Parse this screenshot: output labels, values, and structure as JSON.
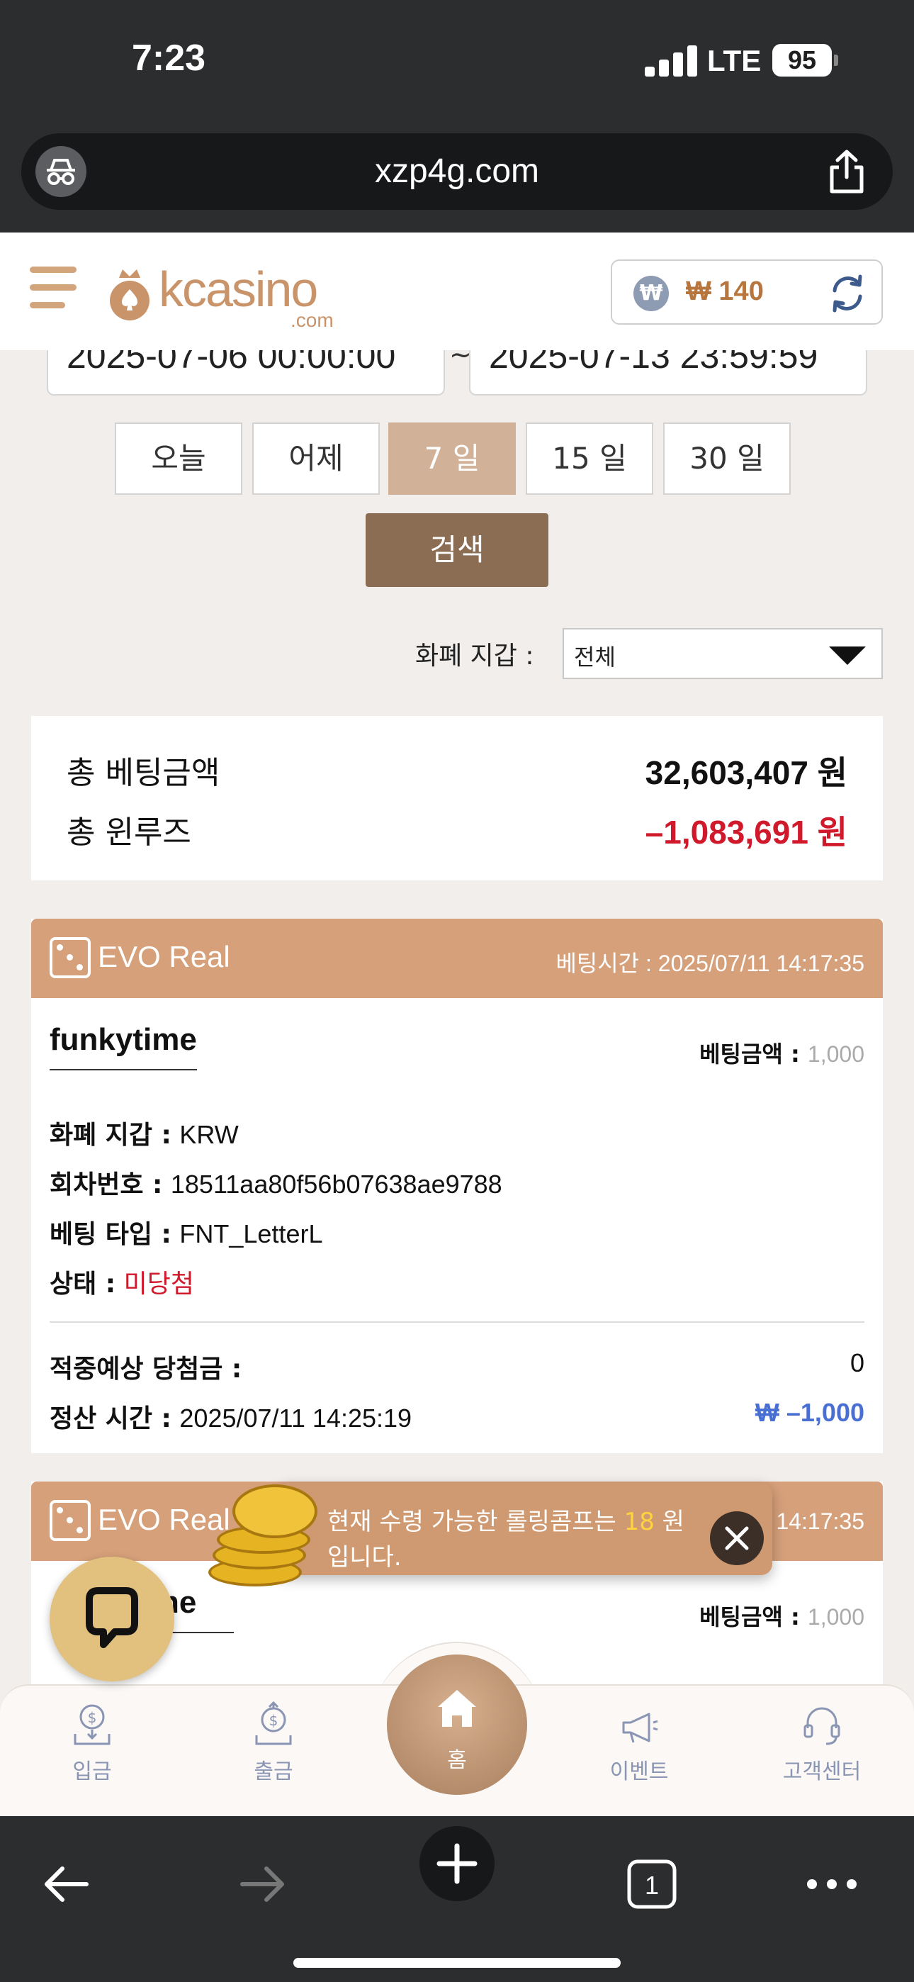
{
  "status_bar": {
    "time": "7:23",
    "network": "LTE",
    "battery": "95"
  },
  "browser": {
    "url": "xzp4g.com",
    "tab_count": "1"
  },
  "header": {
    "logo_main": "kcasino",
    "logo_sub": ".com",
    "balance": "₩ 140",
    "currency_symbol": "₩"
  },
  "filters": {
    "date_from": "2025-07-06 00:00:00",
    "date_to": "2025-07-13 23:59:59",
    "separator": "~",
    "periods": [
      "오늘",
      "어제",
      "7 일",
      "15 일",
      "30 일"
    ],
    "active_period": "7 일",
    "search_label": "검색",
    "wallet_label": "화폐 지갑 :",
    "wallet_value": "전체"
  },
  "summary": {
    "total_bet_label": "총 베팅금액",
    "total_bet_value": "32,603,407 원",
    "total_winloss_label": "총 윈루즈",
    "total_winloss_value": "–1,083,691 원"
  },
  "bets": [
    {
      "provider": "EVO Real",
      "bet_time_label": "베팅시간 :",
      "bet_time": "2025/07/11 14:17:35",
      "game": "funkytime",
      "bet_amount_label": "베팅금액 :",
      "bet_amount": "1,000",
      "wallet_label": "화폐 지갑 :",
      "wallet": "KRW",
      "round_label": "회차번호 :",
      "round": "18511aa80f56b07638ae9788",
      "bet_type_label": "베팅 타입 :",
      "bet_type": "FNT_LetterL",
      "status_label": "상태 :",
      "status": "미당첨",
      "expected_win_label": "적중예상 당첨금 :",
      "expected_win": "0",
      "settle_time_label": "정산 시간 :",
      "settle_time": "2025/07/11 14:25:19",
      "settle_amount": "₩ –1,000"
    },
    {
      "provider": "EVO Real",
      "bet_time": "14:17:35",
      "game": "funkytime",
      "game_visible": "ne",
      "bet_amount_label": "베팅금액 :",
      "bet_amount": "1,000"
    }
  ],
  "toast": {
    "text_before": "현재 수령 가능한 롤링콤프는 ",
    "amount": "18",
    "text_after": " 원 입니다."
  },
  "bottom_nav": {
    "deposit": "입금",
    "withdraw": "출금",
    "home": "홈",
    "events": "이벤트",
    "support": "고객센터"
  },
  "colors": {
    "accent": "#d6a07a",
    "brand": "#c9946a",
    "dark_brown": "#8b6d54",
    "negative": "#d0192b",
    "settle_blue": "#4a6fd3"
  }
}
